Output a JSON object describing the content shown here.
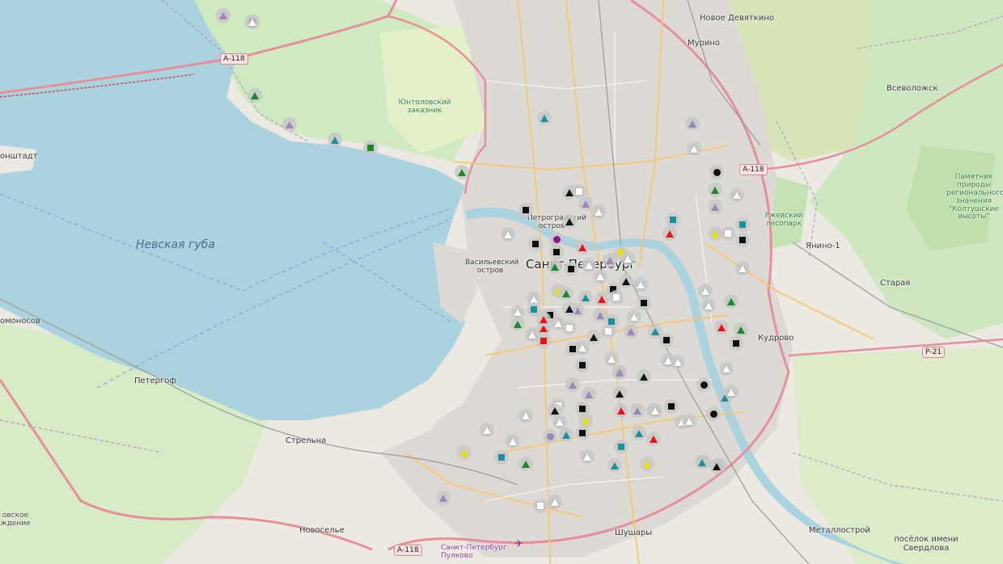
{
  "map": {
    "water_labels": [
      {
        "key": "nevskaya_guba",
        "text": "Невская губа"
      }
    ],
    "place_labels": [
      {
        "key": "novoe_devyatkino",
        "text": "Новое Девяткино"
      },
      {
        "key": "murino",
        "text": "Мурино"
      },
      {
        "key": "vsevolozhsk",
        "text": "Всеволожск"
      },
      {
        "key": "yanino",
        "text": "Янино-1"
      },
      {
        "key": "staraya",
        "text": "Старая"
      },
      {
        "key": "kudrovo",
        "text": "Кудрово"
      },
      {
        "key": "kronshtadt",
        "text": "онштадт"
      },
      {
        "key": "lomonosov",
        "text": "омоносов"
      },
      {
        "key": "petergof",
        "text": "Петергоф"
      },
      {
        "key": "strelna",
        "text": "Стрельна"
      },
      {
        "key": "novoselye",
        "text": "Новоселье"
      },
      {
        "key": "shushary",
        "text": "Шушары"
      },
      {
        "key": "metallostroy",
        "text": "Металлострой"
      },
      {
        "key": "sverdlova",
        "text": "посёлок имени Свердлова"
      },
      {
        "key": "vasilievsky",
        "text": "Васильевский остров"
      },
      {
        "key": "petrogradsky",
        "text": "Петроградский остров"
      },
      {
        "key": "spb",
        "text": "Санкт-Петербург"
      },
      {
        "key": "rezhevskiy",
        "text": "Ржевский лесопарк"
      },
      {
        "key": "yuntolovsky",
        "text": "Юнтоловский заказник"
      },
      {
        "key": "koltushi",
        "text": "Памятник природы регионального значения \"Колтушские высоты\""
      },
      {
        "key": "krasnoe",
        "text": "овское ждение"
      },
      {
        "key": "airport",
        "text": "Санкт-Петербург Пулково"
      }
    ],
    "road_shields": [
      "А-118",
      "А-118",
      "А-118",
      "Р-21"
    ],
    "marker_colors": {
      "red": "#e8141c",
      "green": "#1a8a2a",
      "teal": "#1a8fa0",
      "black": "#111111",
      "white": "#ffffff",
      "lavender": "#9a88b8",
      "yellow": "#e8e000",
      "purple": "#8a1a8a"
    },
    "markers": [
      {
        "s": "tri",
        "c": "red"
      },
      {
        "s": "sq",
        "c": "black"
      },
      {
        "s": "tri",
        "c": "green"
      },
      {
        "s": "tri",
        "c": "lavender"
      },
      {
        "s": "tri",
        "c": "teal"
      },
      {
        "s": "sq",
        "c": "green"
      },
      {
        "s": "tri",
        "c": "green"
      },
      {
        "s": "tri",
        "c": "teal"
      },
      {
        "s": "tri",
        "c": "lavender"
      },
      {
        "s": "tri",
        "c": "white"
      },
      {
        "s": "dot",
        "c": "black"
      },
      {
        "s": "tri",
        "c": "green"
      },
      {
        "s": "tri",
        "c": "white"
      },
      {
        "s": "tri",
        "c": "lavender"
      },
      {
        "s": "sq",
        "c": "teal"
      },
      {
        "s": "tri",
        "c": "red"
      },
      {
        "s": "tri",
        "c": "yellow"
      },
      {
        "s": "sq",
        "c": "white"
      },
      {
        "s": "sq",
        "c": "black"
      },
      {
        "s": "sq",
        "c": "teal"
      },
      {
        "s": "tri",
        "c": "white"
      },
      {
        "s": "tri",
        "c": "green"
      },
      {
        "s": "tri",
        "c": "white"
      },
      {
        "s": "tri",
        "c": "white"
      },
      {
        "s": "tri",
        "c": "black"
      },
      {
        "s": "sq",
        "c": "white"
      },
      {
        "s": "sq",
        "c": "black"
      },
      {
        "s": "tri",
        "c": "black"
      },
      {
        "s": "tri",
        "c": "lavender"
      },
      {
        "s": "tri",
        "c": "white"
      },
      {
        "s": "sq",
        "c": "black"
      },
      {
        "s": "dot",
        "c": "purple"
      },
      {
        "s": "sq",
        "c": "black"
      },
      {
        "s": "tri",
        "c": "white"
      },
      {
        "s": "sq",
        "c": "black"
      },
      {
        "s": "tri",
        "c": "green"
      },
      {
        "s": "tri",
        "c": "white"
      },
      {
        "s": "tri",
        "c": "red"
      },
      {
        "s": "tri",
        "c": "lavender"
      },
      {
        "s": "sq",
        "c": "yellow"
      },
      {
        "s": "tri",
        "c": "white"
      },
      {
        "s": "tri",
        "c": "black"
      },
      {
        "s": "sq",
        "c": "black"
      },
      {
        "s": "tri",
        "c": "white"
      },
      {
        "s": "tri",
        "c": "teal"
      },
      {
        "s": "tri",
        "c": "red"
      },
      {
        "s": "sq",
        "c": "black"
      },
      {
        "s": "tri",
        "c": "white"
      },
      {
        "s": "tri",
        "c": "lavender"
      },
      {
        "s": "sq",
        "c": "white"
      },
      {
        "s": "tri",
        "c": "yellow"
      },
      {
        "s": "tri",
        "c": "green"
      },
      {
        "s": "tri",
        "c": "white"
      },
      {
        "s": "sq",
        "c": "teal"
      },
      {
        "s": "tri",
        "c": "white"
      },
      {
        "s": "tri",
        "c": "green"
      },
      {
        "s": "tri",
        "c": "red"
      },
      {
        "s": "tri",
        "c": "black"
      },
      {
        "s": "tri",
        "c": "white"
      },
      {
        "s": "tri",
        "c": "lavender"
      },
      {
        "s": "sq",
        "c": "white"
      },
      {
        "s": "tri",
        "c": "white"
      },
      {
        "s": "sq",
        "c": "black"
      },
      {
        "s": "tri",
        "c": "black"
      },
      {
        "s": "tri",
        "c": "white"
      },
      {
        "s": "tri",
        "c": "lavender"
      },
      {
        "s": "sq",
        "c": "teal"
      },
      {
        "s": "sq",
        "c": "white"
      },
      {
        "s": "tri",
        "c": "red"
      },
      {
        "s": "sq",
        "c": "red"
      },
      {
        "s": "tri",
        "c": "white"
      },
      {
        "s": "sq",
        "c": "black"
      },
      {
        "s": "tri",
        "c": "black"
      },
      {
        "s": "tri",
        "c": "white"
      },
      {
        "s": "sq",
        "c": "black"
      },
      {
        "s": "tri",
        "c": "lavender"
      },
      {
        "s": "tri",
        "c": "white"
      },
      {
        "s": "dot",
        "c": "purple"
      },
      {
        "s": "tri",
        "c": "black"
      },
      {
        "s": "tri",
        "c": "lavender"
      },
      {
        "s": "tri",
        "c": "teal"
      },
      {
        "s": "sq",
        "c": "black"
      },
      {
        "s": "tri",
        "c": "white"
      },
      {
        "s": "dot",
        "c": "black"
      },
      {
        "s": "tri",
        "c": "white"
      },
      {
        "s": "tri",
        "c": "teal"
      },
      {
        "s": "sq",
        "c": "black"
      },
      {
        "s": "tri",
        "c": "red"
      },
      {
        "s": "tri",
        "c": "lavender"
      },
      {
        "s": "tri",
        "c": "white"
      },
      {
        "s": "tri",
        "c": "teal"
      },
      {
        "s": "sq",
        "c": "black"
      },
      {
        "s": "tri",
        "c": "yellow"
      },
      {
        "s": "tri",
        "c": "white"
      },
      {
        "s": "sq",
        "c": "white"
      },
      {
        "s": "tri",
        "c": "teal"
      },
      {
        "s": "sq",
        "c": "teal"
      },
      {
        "s": "tri",
        "c": "white"
      },
      {
        "s": "tri",
        "c": "yellow"
      },
      {
        "s": "tri",
        "c": "green"
      },
      {
        "s": "tri",
        "c": "white"
      },
      {
        "s": "tri",
        "c": "lavender"
      },
      {
        "s": "sq",
        "c": "white"
      },
      {
        "s": "tri",
        "c": "white"
      },
      {
        "s": "tri",
        "c": "teal"
      },
      {
        "s": "tri",
        "c": "white"
      },
      {
        "s": "tri",
        "c": "yellow"
      },
      {
        "s": "tri",
        "c": "white"
      },
      {
        "s": "tri",
        "c": "lavender"
      },
      {
        "s": "tri",
        "c": "red"
      },
      {
        "s": "tri",
        "c": "lavender"
      },
      {
        "s": "tri",
        "c": "white"
      },
      {
        "s": "dot",
        "c": "lavender"
      },
      {
        "s": "tri",
        "c": "black"
      },
      {
        "s": "tri",
        "c": "teal"
      },
      {
        "s": "sq",
        "c": "teal"
      },
      {
        "s": "tri",
        "c": "black"
      },
      {
        "s": "tri",
        "c": "red"
      },
      {
        "s": "sq",
        "c": "black"
      },
      {
        "s": "tri",
        "c": "green"
      },
      {
        "s": "tri",
        "c": "white"
      },
      {
        "s": "dot",
        "c": "black"
      },
      {
        "s": "tri",
        "c": "white"
      },
      {
        "s": "sq",
        "c": "black"
      },
      {
        "s": "tri",
        "c": "white"
      },
      {
        "s": "tri",
        "c": "white"
      },
      {
        "s": "tri",
        "c": "lavender"
      },
      {
        "s": "tri",
        "c": "white"
      }
    ]
  }
}
